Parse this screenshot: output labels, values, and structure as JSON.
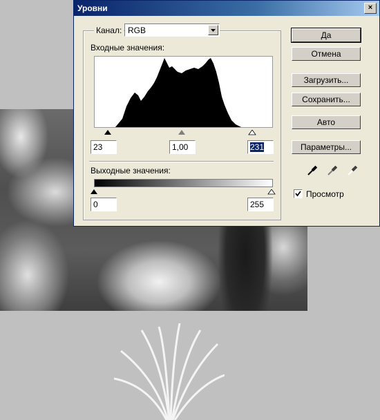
{
  "window": {
    "title": "Уровни",
    "close_glyph": "×"
  },
  "channel": {
    "label": "Канал:",
    "value": "RGB"
  },
  "input_levels": {
    "label": "Входные значения:",
    "black": "23",
    "gray": "1,00",
    "white": "231"
  },
  "output_levels": {
    "label": "Выходные значения:",
    "black": "0",
    "white": "255"
  },
  "buttons": {
    "ok": "Да",
    "cancel": "Отмена",
    "load": "Загрузить...",
    "save": "Сохранить...",
    "auto": "Авто",
    "options": "Параметры..."
  },
  "preview": {
    "label": "Просмотр",
    "checked": true
  },
  "icons": {
    "eyedropper_black": "eyedropper-black-icon",
    "eyedropper_gray": "eyedropper-gray-icon",
    "eyedropper_white": "eyedropper-white-icon"
  },
  "colors": {
    "titlebar": "#0a246a",
    "dialog_bg": "#ece9d8",
    "selection": "#0a246a"
  }
}
